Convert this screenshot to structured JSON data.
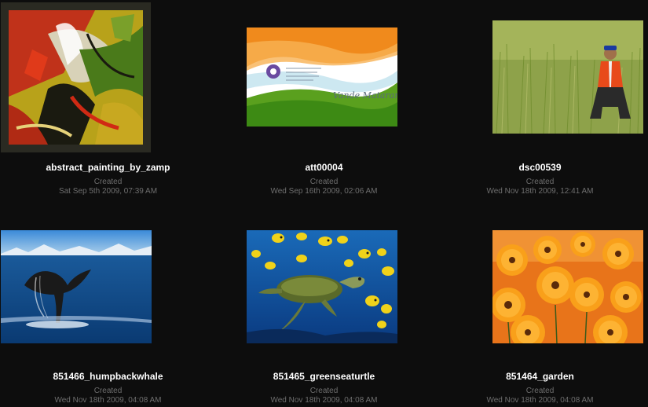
{
  "gallery": {
    "items": [
      {
        "title": "abstract_painting_by_zamp",
        "label": "Created",
        "date": "Sat Sep 5th 2009, 07:39 AM",
        "image": "abstract-painting-image"
      },
      {
        "title": "att00004",
        "label": "Created",
        "date": "Wed Sep 16th 2009, 02:06 AM",
        "image": "tricolor-card-image",
        "image_text": "Vande Mataram!"
      },
      {
        "title": "dsc00539",
        "label": "Created",
        "date": "Wed Nov 18th 2009, 12:41 AM",
        "image": "man-in-field-image"
      },
      {
        "title": "851466_humpbackwhale",
        "label": "Created",
        "date": "Wed Nov 18th 2009, 04:08 AM",
        "image": "whale-tail-image"
      },
      {
        "title": "851465_greenseaturtle",
        "label": "Created",
        "date": "Wed Nov 18th 2009, 04:08 AM",
        "image": "sea-turtle-image"
      },
      {
        "title": "851464_garden",
        "label": "Created",
        "date": "Wed Nov 18th 2009, 04:08 AM",
        "image": "orange-flowers-image"
      }
    ]
  },
  "colors": {
    "background": "#0d0d0d",
    "title_text": "#ffffff",
    "meta_text": "#6e6e6e"
  }
}
